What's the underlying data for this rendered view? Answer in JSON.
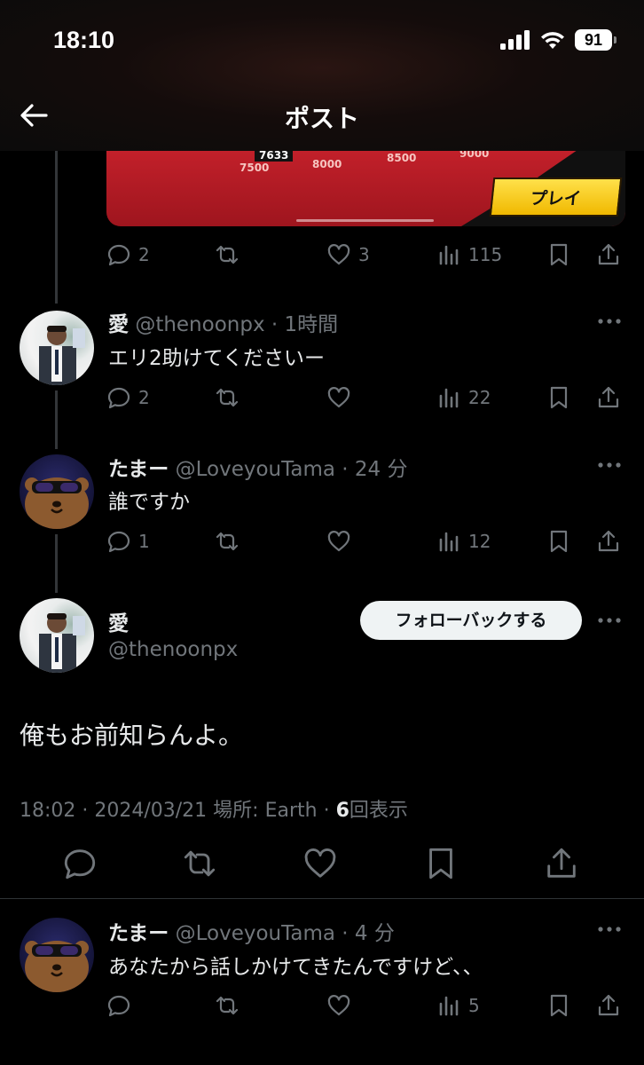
{
  "status_bar": {
    "time": "18:10",
    "battery": "91"
  },
  "header": {
    "title": "ポスト"
  },
  "media": {
    "score_badge": "7633",
    "numbers": [
      "7500",
      "8000",
      "8500",
      "9000"
    ],
    "play_label": "プレイ"
  },
  "tweets": [
    {
      "replies": "2",
      "retweets": "",
      "likes": "3",
      "views": "115"
    },
    {
      "name": "愛",
      "handle": "@thenoonpx",
      "time": "1時間",
      "text": "エリ2助けてくださいー",
      "replies": "2",
      "retweets": "",
      "likes": "",
      "views": "22"
    },
    {
      "name": "たまー",
      "handle": "@LoveyouTama",
      "time": "24 分",
      "text": "誰ですか",
      "replies": "1",
      "retweets": "",
      "likes": "",
      "views": "12"
    }
  ],
  "main_post": {
    "name": "愛",
    "handle": "@thenoonpx",
    "follow_label": "フォローバックする",
    "text": "俺もお前知らんよ。",
    "datetime": "18:02 · 2024/03/21 場所: Earth · ",
    "view_count": "6",
    "view_label": "回表示"
  },
  "reply": {
    "name": "たまー",
    "handle": "@LoveyouTama",
    "time": "4 分",
    "text": "あなたから話しかけてきたんですけど、、",
    "replies": "",
    "retweets": "",
    "likes": "",
    "views": "5"
  },
  "colors": {
    "background": "#000000",
    "text": "#e7e9ea",
    "muted": "#71767b",
    "play_button": "#f5c400"
  },
  "icons": [
    "back-arrow-icon",
    "reply-icon",
    "retweet-icon",
    "like-icon",
    "views-icon",
    "bookmark-icon",
    "share-icon",
    "more-icon"
  ]
}
